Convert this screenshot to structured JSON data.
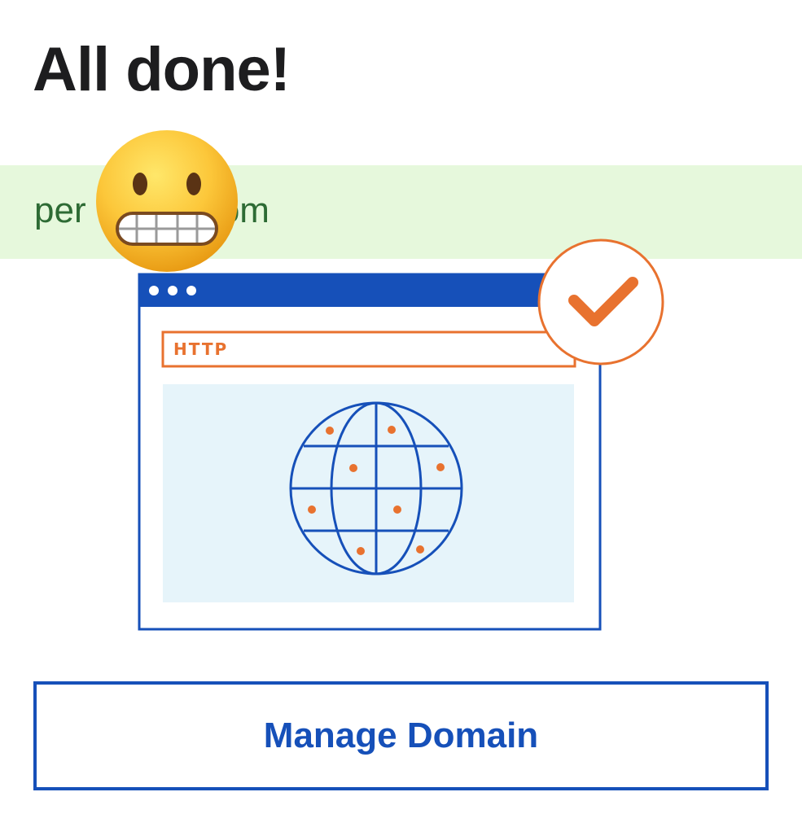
{
  "page": {
    "title": "All done!"
  },
  "domain": {
    "visible_start": "per",
    "visible_end": ".com"
  },
  "illustration": {
    "address_bar_label": "HTTP",
    "icons": [
      "browser-window-icon",
      "globe-icon",
      "checkmark-icon"
    ]
  },
  "sticker": {
    "icon": "grimacing-face-emoji"
  },
  "actions": {
    "manage_label": "Manage Domain"
  },
  "colors": {
    "brand_blue": "#1650b9",
    "accent_orange": "#e8722f",
    "banner_green": "#e6f8dc",
    "domain_text_green": "#2d6b34",
    "globe_panel": "#e6f4fa"
  }
}
